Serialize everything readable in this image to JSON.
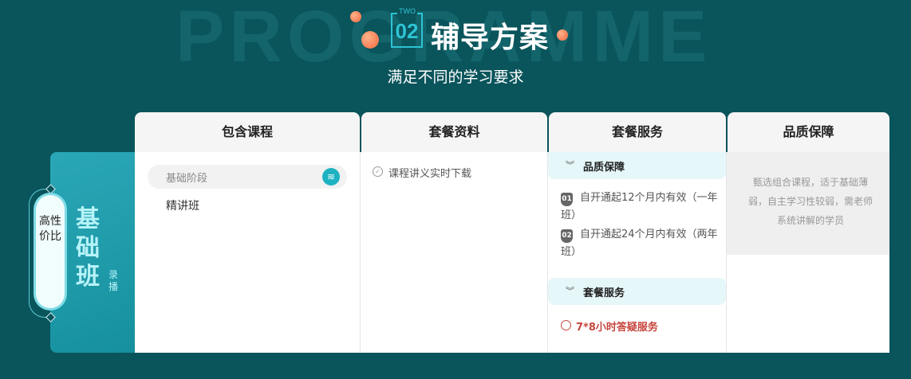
{
  "header": {
    "bg_word": "PROGRAMME",
    "badge_small": "TWO",
    "badge_number": "02",
    "title": "辅导方案",
    "subtitle": "满足不同的学习要求"
  },
  "plan": {
    "tag": "高性价比",
    "name": "基础班",
    "mode": "录播"
  },
  "columns": [
    "包含课程",
    "套餐资料",
    "套餐服务",
    "品质保障"
  ],
  "courses": {
    "stage": "基础阶段",
    "items": [
      "精讲班"
    ]
  },
  "materials": [
    "课程讲义实时下载"
  ],
  "services": {
    "group1_title": "品质保障",
    "group1_items": [
      {
        "badge": "01",
        "text": "自开通起12个月内有效（一年班）"
      },
      {
        "badge": "02",
        "text": "自开通起24个月内有效（两年班）"
      }
    ],
    "group2_title": "套餐服务",
    "group2_items": [
      "7*8小时答疑服务"
    ]
  },
  "quality": "甄选组合课程，适于基础薄弱，自主学习性较弱，需老师系统讲解的学员",
  "colors": {
    "background": "#0a545b",
    "accent": "#1eb2c2",
    "highlight": "#c7463d"
  }
}
